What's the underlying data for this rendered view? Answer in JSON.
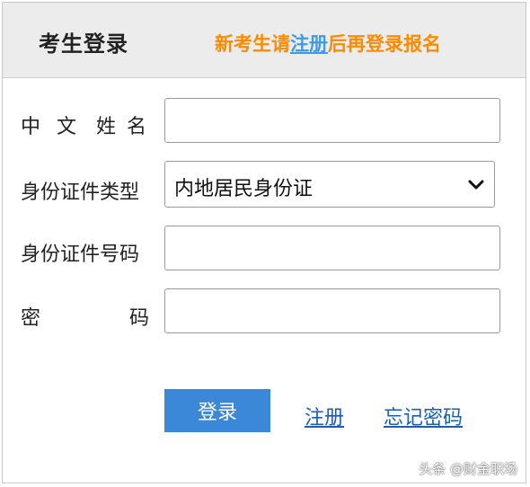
{
  "header": {
    "title": "考生登录",
    "notice_prefix": "新考生请",
    "notice_link": "注册",
    "notice_suffix": "后再登录报名"
  },
  "form": {
    "name_label_chars": [
      "中",
      "文",
      "姓",
      "名"
    ],
    "id_type_label": "身份证件类型",
    "id_type_value": "内地居民身份证",
    "id_number_label": "身份证件号码",
    "password_label_chars": [
      "密",
      "码"
    ]
  },
  "actions": {
    "login_label": "登录",
    "register_label": "注册",
    "forgot_label": "忘记密码"
  },
  "watermark": "头条 @财金职场",
  "colors": {
    "notice": "#ff8a00",
    "notice_link": "#3b9be8",
    "login_button": "#3b87d8",
    "link": "#1a5fb4",
    "header_bg": "#ececec"
  }
}
